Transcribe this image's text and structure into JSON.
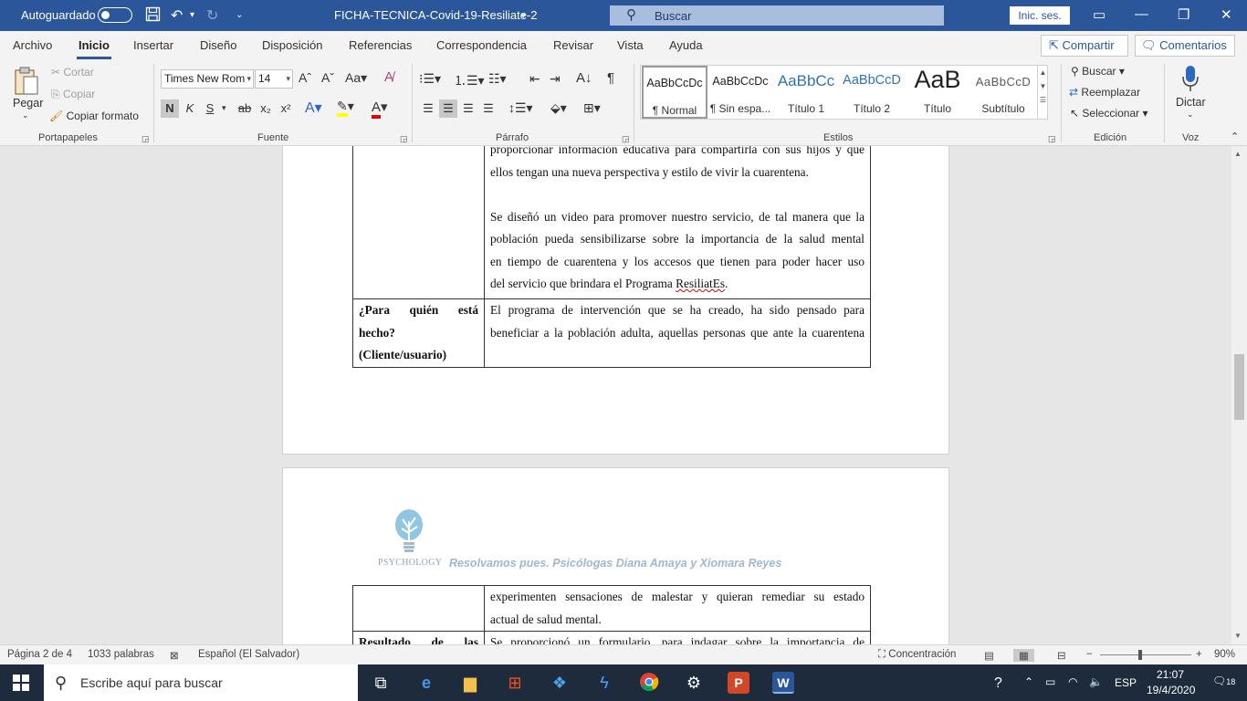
{
  "titlebar": {
    "autosave_label": "Autoguardado",
    "doc_title": "FICHA-TECNICA-Covid-19-Resiliate-2",
    "search_placeholder": "Buscar",
    "signin_label": "Inic. ses."
  },
  "tabs": [
    "Archivo",
    "Inicio",
    "Insertar",
    "Diseño",
    "Disposición",
    "Referencias",
    "Correspondencia",
    "Revisar",
    "Vista",
    "Ayuda"
  ],
  "share_label": "Compartir",
  "comments_label": "Comentarios",
  "ribbon": {
    "clipboard": {
      "paste": "Pegar",
      "cut": "Cortar",
      "copy": "Copiar",
      "format_painter": "Copiar formato",
      "group": "Portapapeles"
    },
    "font": {
      "name": "Times New Rom",
      "size": "14",
      "group": "Fuente",
      "bold": "N",
      "italic": "K",
      "underline": "S",
      "strike": "ab",
      "subscript": "x₂",
      "superscript": "x²"
    },
    "paragraph": {
      "group": "Párrafo"
    },
    "styles": {
      "group": "Estilos",
      "items": [
        {
          "preview": "AaBbCcDc",
          "label": "¶ Normal"
        },
        {
          "preview": "AaBbCcDc",
          "label": "¶ Sin espa..."
        },
        {
          "preview": "AaBbCc",
          "label": "Título 1"
        },
        {
          "preview": "AaBbCcD",
          "label": "Título 2"
        },
        {
          "preview": "AaB",
          "label": "Título"
        },
        {
          "preview": "AaBbCcD",
          "label": "Subtítulo"
        }
      ]
    },
    "editing": {
      "group": "Edición",
      "find": "Buscar",
      "replace": "Reemplazar",
      "select": "Seleccionar"
    },
    "voice": {
      "group": "Voz",
      "dictate": "Dictar"
    }
  },
  "document": {
    "page1": {
      "cell_top_lines": [
        "proporcionar información educativa para compartirla con sus hijos y que",
        "ellos tengan una nueva perspectiva y estilo de vivir la cuarentena."
      ],
      "cell_para2_lines": [
        "Se diseñó un video para promover nuestro servicio, de tal manera que la",
        "población pueda sensibilizarse sobre la importancia de la salud mental",
        "en tiempo de cuarentena y los accesos que tienen para poder hacer uso",
        "del servicio que brindara el Programa"
      ],
      "program_name": "ResiliatEs",
      "period": ".",
      "row2_left_lines": [
        "¿Para quién está",
        "hecho?",
        "(Cliente/usuario)"
      ],
      "row2_right_lines": [
        "El programa de intervención que se ha creado, ha sido pensado para",
        "beneficiar a la población adulta, aquellas personas que ante la cuarentena"
      ]
    },
    "page2": {
      "header_logo_text": "PSYCHOLOGY",
      "header_text": "Resolvamos pues. Psicólogas Diana Amaya y Xiomara Reyes",
      "row1_right_lines": [
        "experimenten sensaciones de malestar y quieran remediar su estado",
        "actual de salud mental."
      ],
      "row2_left": "Resultado de las",
      "row2_right": "Se proporcionó un formulario, para indagar sobre la importancia de"
    }
  },
  "statusbar": {
    "page": "Página 2 de 4",
    "words": "1033 palabras",
    "language": "Español (El Salvador)",
    "focus": "Concentración",
    "zoom": "90%"
  },
  "taskbar": {
    "search_placeholder": "Escribe aquí para buscar",
    "lang": "ESP",
    "time": "21:07",
    "date": "19/4/2020",
    "notif_count": "18"
  }
}
